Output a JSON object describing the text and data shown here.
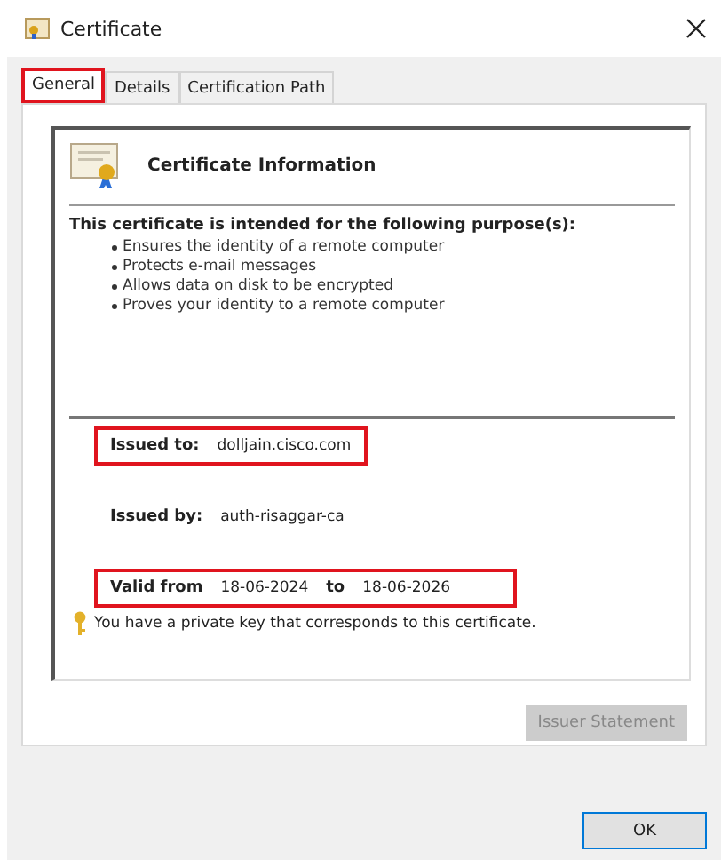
{
  "window": {
    "title": "Certificate"
  },
  "tabs": [
    {
      "label": "General",
      "selected": true,
      "highlighted": true
    },
    {
      "label": "Details",
      "selected": false,
      "highlighted": false
    },
    {
      "label": "Certification Path",
      "selected": false,
      "highlighted": false
    }
  ],
  "info": {
    "heading": "Certificate Information",
    "purpose_title": "This certificate is intended for the following purpose(s):",
    "purposes": [
      "Ensures the identity of a remote computer",
      "Protects e-mail messages",
      "Allows data on disk to be encrypted",
      "Proves your identity to a remote computer"
    ],
    "issued_to": {
      "label": "Issued to:",
      "value": "dolljain.cisco.com",
      "highlighted": true
    },
    "issued_by": {
      "label": "Issued by:",
      "value": "auth-risaggar-ca"
    },
    "validity": {
      "label_from": "Valid from",
      "from": "18-06-2024",
      "label_to": "to",
      "to": "18-06-2026",
      "highlighted": true
    },
    "key_note": "You have a private key that corresponds to this certificate."
  },
  "issuer_statement": {
    "label": "Issuer Statement",
    "disabled": true
  },
  "ok": {
    "label": "OK"
  }
}
